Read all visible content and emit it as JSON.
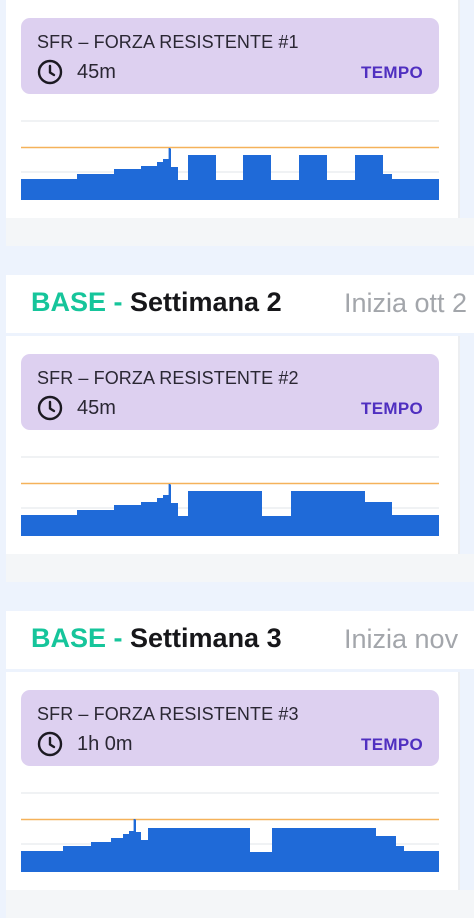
{
  "colors": {
    "page_bg": "#edf3fd",
    "header_bg": "#ddd0f0",
    "tag_color": "#4f2fc0",
    "phase_color": "#16c59b",
    "bar_color": "#1f6ad8",
    "threshold_line": "#f5b25a",
    "grid_line": "#e2e5ea"
  },
  "icons": {
    "duration": "clock-icon"
  },
  "workouts": [
    {
      "title": "SFR – FORZA RESISTENTE #1",
      "duration": "45m",
      "tag": "TEMPO"
    },
    {
      "title": "SFR – FORZA RESISTENTE #2",
      "duration": "45m",
      "tag": "TEMPO"
    },
    {
      "title": "SFR – FORZA RESISTENTE #3",
      "duration": "1h 0m",
      "tag": "TEMPO"
    }
  ],
  "weeks": [
    {
      "phase": "BASE -",
      "name": "Settimana 2",
      "start": "Inizia ott 2"
    },
    {
      "phase": "BASE -",
      "name": "Settimana 3",
      "start": "Inizia nov"
    }
  ]
}
